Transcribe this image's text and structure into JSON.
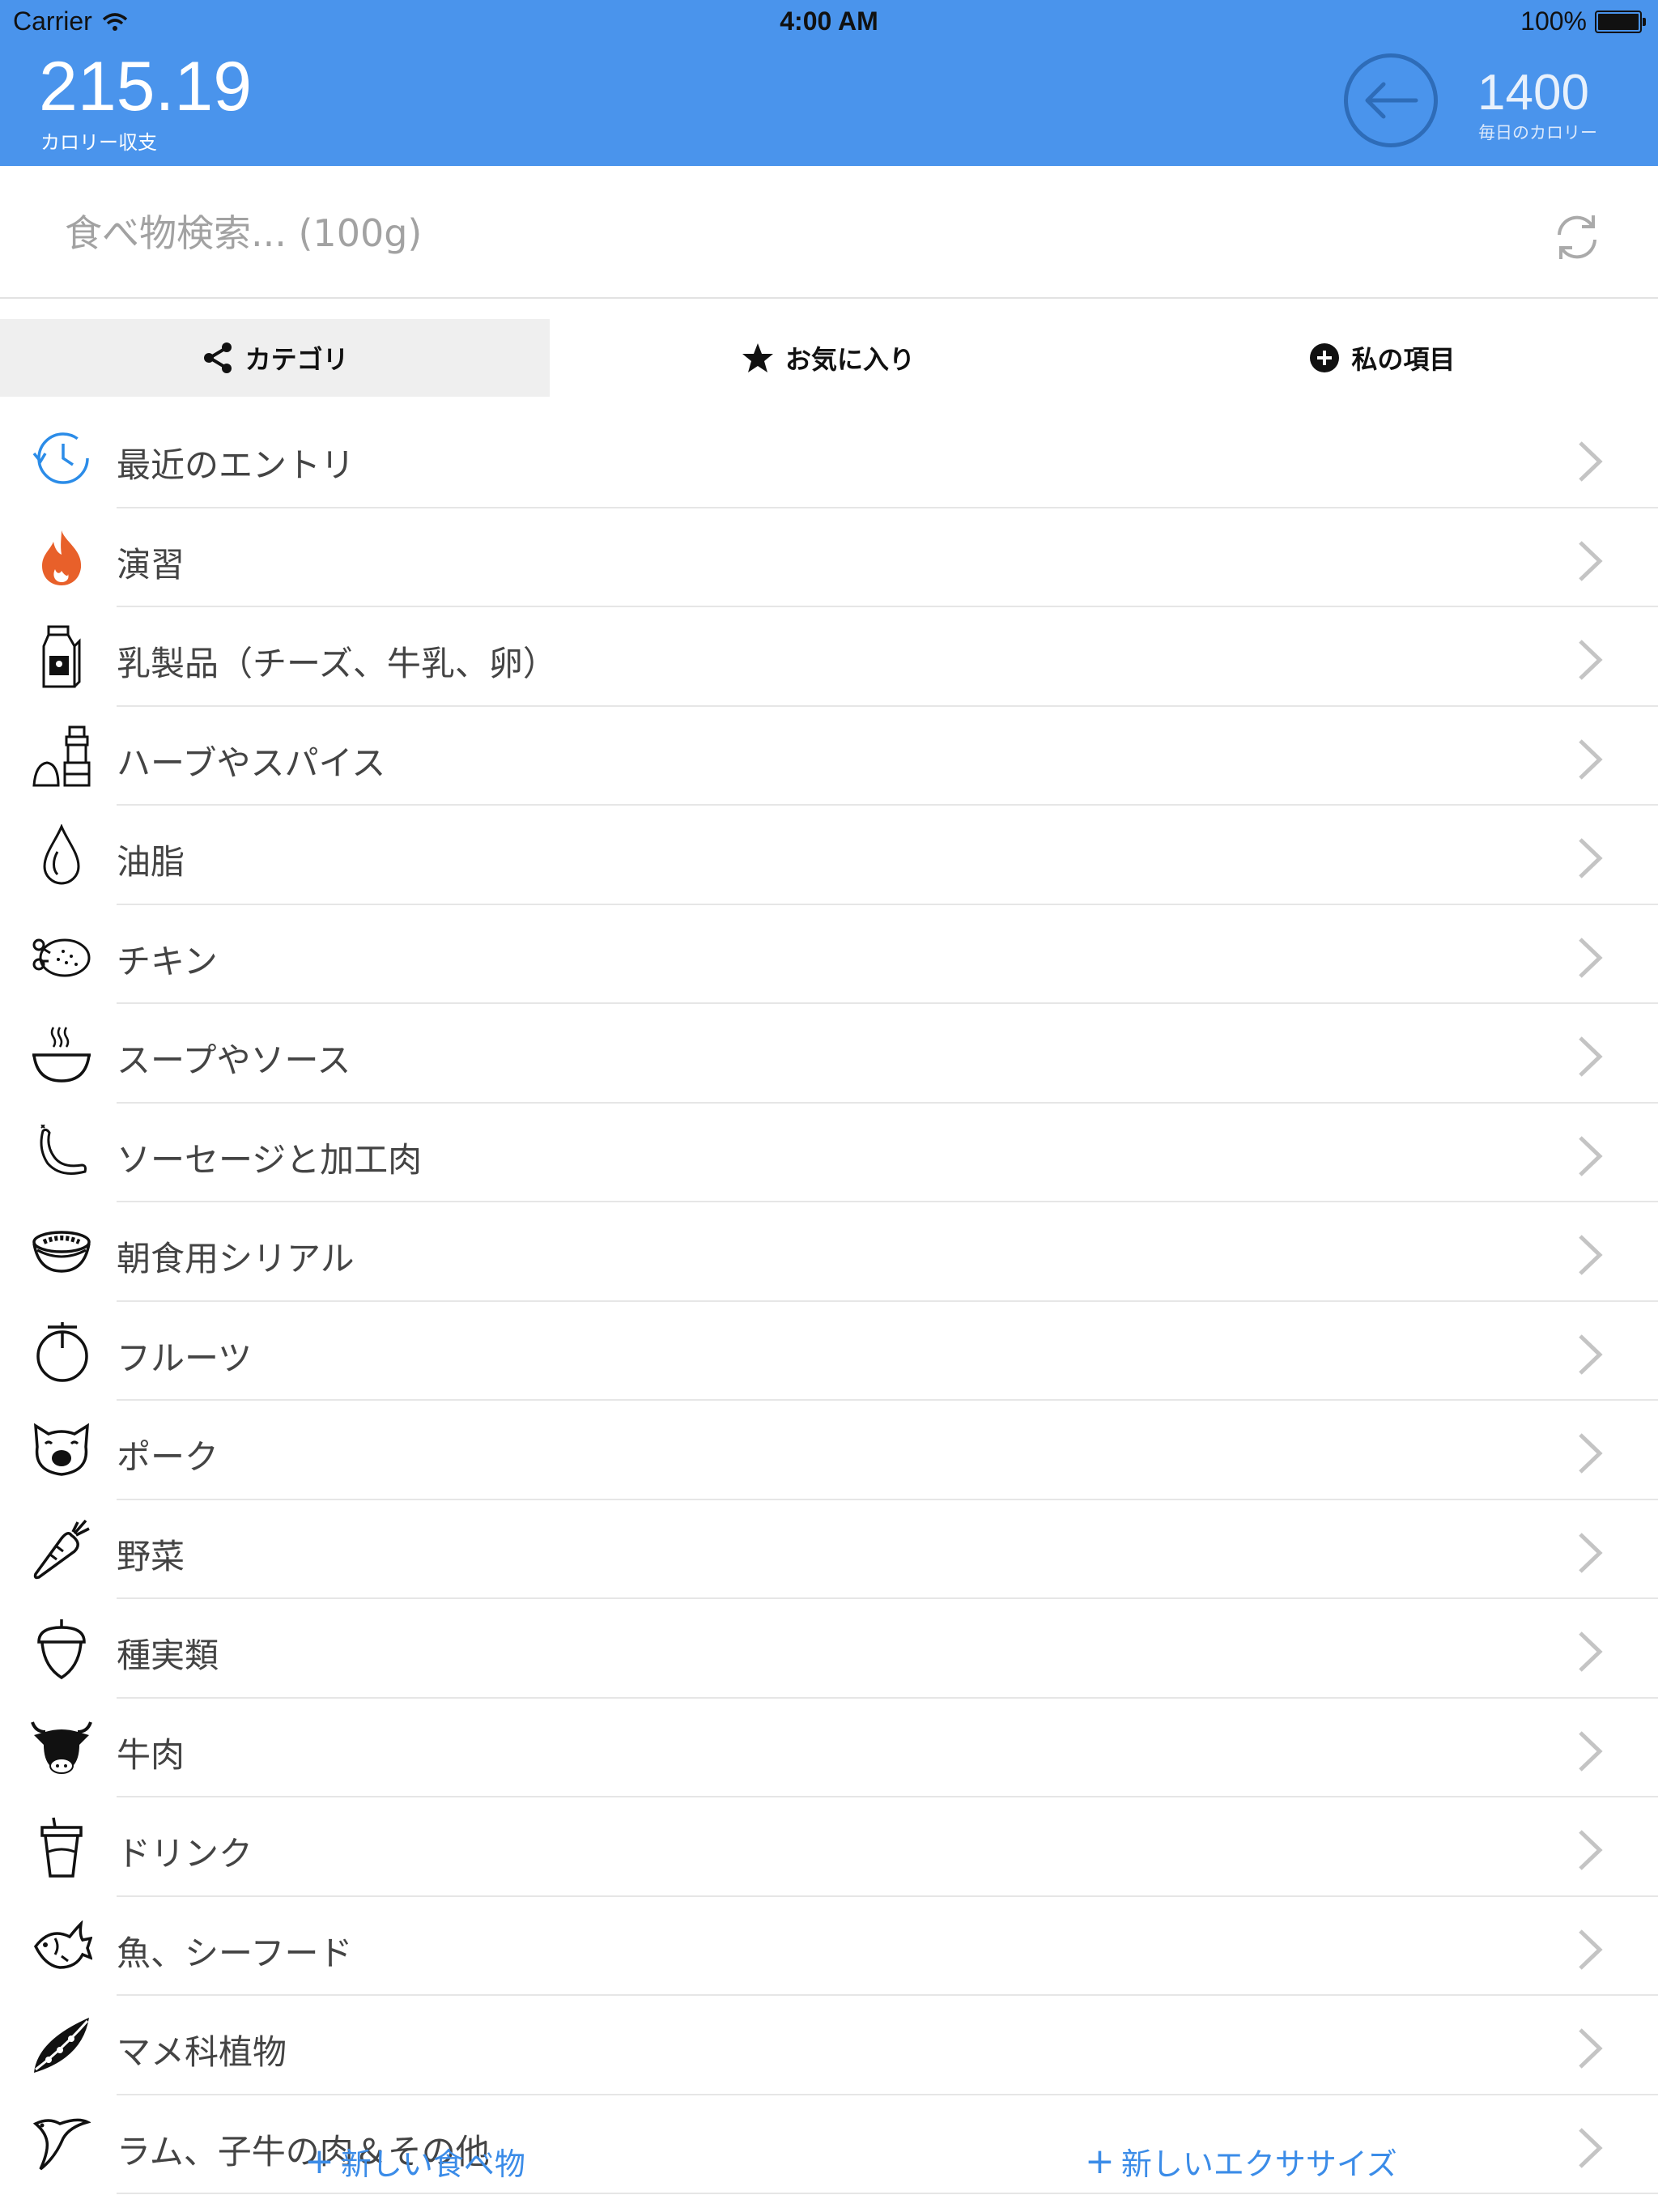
{
  "status": {
    "carrier": "Carrier",
    "time": "4:00 AM",
    "battery": "100%"
  },
  "header": {
    "balance_value": "215.19",
    "balance_label": "カロリー収支",
    "daily_value": "1400",
    "daily_label": "毎日のカロリー"
  },
  "search": {
    "placeholder": "食べ物検索... (100g)"
  },
  "tabs": [
    {
      "label": "カテゴリ",
      "icon": "share-icon",
      "active": true
    },
    {
      "label": "お気に入り",
      "icon": "star-icon",
      "active": false
    },
    {
      "label": "私の項目",
      "icon": "plus-circle-icon",
      "active": false
    }
  ],
  "categories": [
    {
      "label": "最近のエントリ",
      "icon": "history-clock-icon",
      "color": "#2b8ce8"
    },
    {
      "label": "演習",
      "icon": "flame-icon",
      "color": "#e8602a"
    },
    {
      "label": "乳製品（チーズ、牛乳、卵）",
      "icon": "milk-carton-icon"
    },
    {
      "label": "ハーブやスパイス",
      "icon": "spice-grinder-icon"
    },
    {
      "label": "油脂",
      "icon": "oil-drop-icon"
    },
    {
      "label": "チキン",
      "icon": "roast-chicken-icon"
    },
    {
      "label": "スープやソース",
      "icon": "soup-bowl-icon"
    },
    {
      "label": "ソーセージと加工肉",
      "icon": "sausage-icon"
    },
    {
      "label": "朝食用シリアル",
      "icon": "cereal-bowl-icon"
    },
    {
      "label": "フルーツ",
      "icon": "fruit-icon"
    },
    {
      "label": "ポーク",
      "icon": "pig-icon"
    },
    {
      "label": "野菜",
      "icon": "carrot-icon"
    },
    {
      "label": "種実類",
      "icon": "acorn-icon"
    },
    {
      "label": "牛肉",
      "icon": "cow-icon"
    },
    {
      "label": "ドリンク",
      "icon": "drink-cup-icon"
    },
    {
      "label": "魚、シーフード",
      "icon": "fish-icon"
    },
    {
      "label": "マメ科植物",
      "icon": "pea-pod-icon"
    },
    {
      "label": "ラム、子牛の肉＆その他",
      "icon": "bird-icon"
    }
  ],
  "bottom": {
    "new_food": "新しい食べ物",
    "new_exercise": "新しいエクササイズ"
  },
  "colors": {
    "header_bg": "#4a94ec",
    "accent": "#3b8ce8"
  }
}
